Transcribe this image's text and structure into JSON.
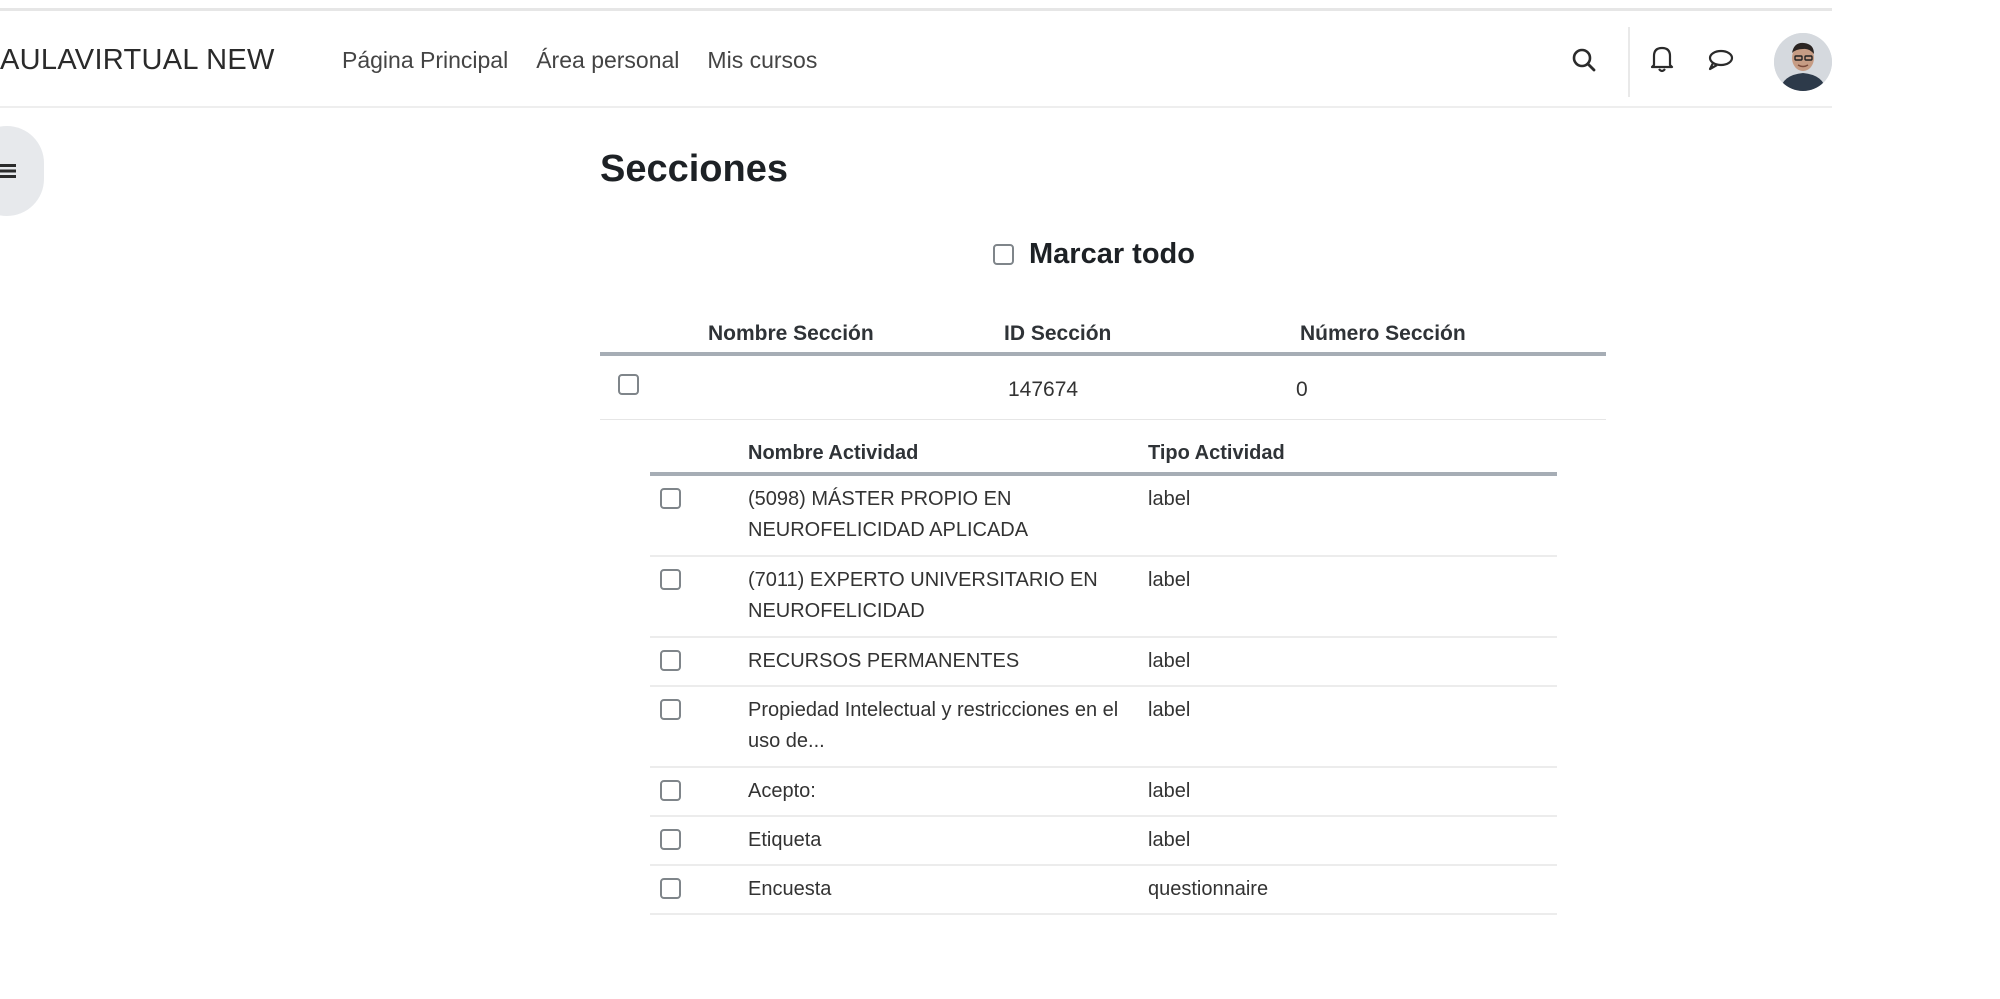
{
  "navbar": {
    "brand": "AULAVIRTUAL NEW",
    "links": [
      "Página Principal",
      "Área personal",
      "Mis cursos"
    ],
    "icons": [
      "search-icon",
      "bell-icon",
      "chat-bubble-icon"
    ]
  },
  "drawer": {
    "icon": "menu-bars-icon"
  },
  "page": {
    "title": "Secciones",
    "check_all_label": "Marcar todo"
  },
  "sections_table": {
    "headers": [
      "Nombre Sección",
      "ID Sección",
      "Número Sección"
    ],
    "rows": [
      {
        "name": "",
        "id": "147674",
        "number": "0"
      }
    ]
  },
  "activities_table": {
    "headers": [
      "Nombre Actividad",
      "Tipo Actividad"
    ],
    "rows": [
      {
        "name": "(5098) MÁSTER PROPIO EN NEUROFELICIDAD APLICADA",
        "type": "label"
      },
      {
        "name": "(7011) EXPERTO UNIVERSITARIO EN NEUROFELICIDAD",
        "type": "label"
      },
      {
        "name": "RECURSOS PERMANENTES",
        "type": "label"
      },
      {
        "name": "Propiedad Intelectual y restricciones en el uso de...",
        "type": "label"
      },
      {
        "name": "Acepto:",
        "type": "label"
      },
      {
        "name": "Etiqueta",
        "type": "label"
      },
      {
        "name": "Encuesta",
        "type": "questionnaire"
      }
    ]
  },
  "colors": {
    "header_rule": "#a6adb5",
    "row_divider": "#ececec",
    "drawer_bg": "#e7e9ec"
  }
}
